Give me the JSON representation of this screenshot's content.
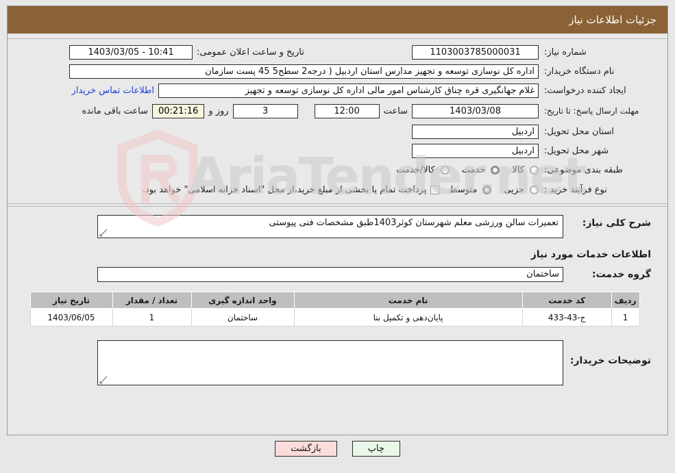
{
  "header": {
    "title": "جزئیات اطلاعات نیاز"
  },
  "summary": {
    "need_number_label": "شماره نیاز:",
    "need_number_value": "1103003785000031",
    "announce_label": "تاریخ و ساعت اعلان عمومی:",
    "announce_value": "1403/03/05 - 10:41",
    "buyer_org_label": "نام دستگاه خریدار:",
    "buyer_org_value": "اداره کل نوسازی   توسعه و تجهیز مدارس استان اردبیل ( درجه2  سطح5  45 پست سازمان",
    "requester_label": "ایجاد کننده درخواست:",
    "requester_value": "غلام جهانگیری قره چناق کارشناس امور مالی اداره کل نوسازی   توسعه و تجهیز",
    "contact_link": "اطلاعات تماس خریدار",
    "deadline_label": "مهلت ارسال پاسخ: تا تاریخ:",
    "deadline_date": "1403/03/08",
    "deadline_hour_label": "ساعت",
    "deadline_hour_value": "12:00",
    "days_remaining": "3",
    "days_join_label": "روز و",
    "countdown": "00:21:16",
    "countdown_suffix": "ساعت باقی مانده",
    "province_label": "استان محل تحویل:",
    "province_value": "اردبیل",
    "city_label": "شهر محل تحویل:",
    "city_value": "اردبیل",
    "category_label": "طبقه بندی موضوعی:",
    "category_options": [
      {
        "label": "کالا",
        "selected": false
      },
      {
        "label": "خدمت",
        "selected": true
      },
      {
        "label": "کالا/خدمت",
        "selected": false
      }
    ],
    "process_label": "نوع فرآیند خرید :",
    "process_options": [
      {
        "label": "جزیی",
        "selected": false
      },
      {
        "label": "متوسط",
        "selected": true
      }
    ],
    "treasury_checkbox_label": "پرداخت تمام یا بخشی از مبلغ خرید،از محل \"اسناد خزانه اسلامی\" خواهد بود.",
    "treasury_checked": false
  },
  "need_description": {
    "label": "شرح کلی نیاز:",
    "value": "تعمیرات سالن ورزشی معلم شهرستان کوثر1403طبق مشخصات فنی پیوستی"
  },
  "services": {
    "section_title": "اطلاعات خدمات مورد نیاز",
    "group_label": "گروه خدمت:",
    "group_value": "ساختمان",
    "table": {
      "columns": [
        "ردیف",
        "کد خدمت",
        "نام خدمت",
        "واحد اندازه گیری",
        "تعداد / مقدار",
        "تاریخ نیاز"
      ],
      "rows": [
        {
          "index": "1",
          "code": "ج-43-433",
          "name": "پایان‌دهی و تکمیل بنا",
          "unit": "ساختمان",
          "quantity": "1",
          "need_date": "1403/06/05"
        }
      ]
    }
  },
  "buyer_notes": {
    "label": "توضیحات خریدار:",
    "value": ""
  },
  "footer": {
    "print_label": "چاپ",
    "back_label": "بازگشت"
  },
  "watermark": {
    "text": "AriaTender.net"
  },
  "colors": {
    "titlebar": "#8b6236",
    "page_bg": "#e7e7e7",
    "link": "#1b3fd6",
    "countdown_bg": "#f7f5dd",
    "print_btn": "#e9f7e9",
    "back_btn": "#fbdcdc",
    "table_header": "#bfbfbf"
  }
}
